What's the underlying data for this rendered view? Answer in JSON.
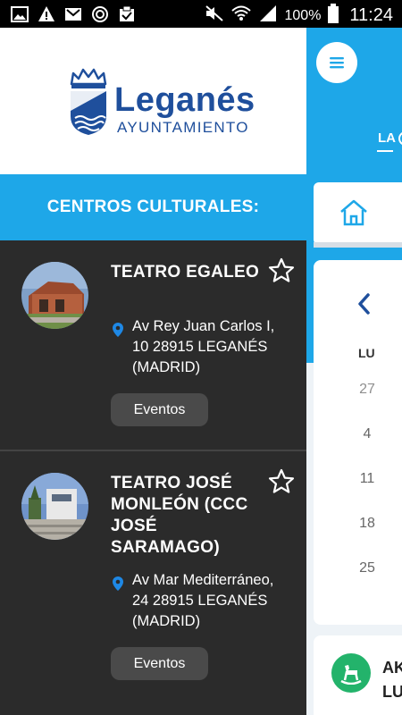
{
  "status_bar": {
    "left_icons": [
      "image-icon",
      "warning-icon",
      "gmail-icon",
      "sync-icon",
      "clipboard-check-icon"
    ],
    "right_icons": [
      "mute-icon",
      "wifi-icon",
      "signal-icon",
      "battery-icon"
    ],
    "battery_percent": "100%",
    "time": "11:24"
  },
  "drawer": {
    "logo": {
      "name": "Leganés",
      "subtitle": "AYUNTAMIENTO",
      "color": "#1f4f9c"
    },
    "section_title": "CENTROS CULTURALES:",
    "accent_color": "#1ea7e8",
    "venues": [
      {
        "name": "TEATRO EGALEO",
        "address": "Av Rey Juan Carlos I, 10 28915 LEGANÉS (MADRID)",
        "events_label": "Eventos",
        "favorite_icon": "star-outline-icon",
        "location_icon": "location-pin-icon"
      },
      {
        "name": "TEATRO JOSÉ MONLEÓN (CCC JOSÉ SARAMAGO)",
        "address": "Av Mar Mediterráneo, 24 28915 LEGANÉS (MADRID)",
        "events_label": "Eventos",
        "favorite_icon": "star-outline-icon",
        "location_icon": "location-pin-icon"
      }
    ]
  },
  "background_app": {
    "menu_icon": "hamburger-menu-icon",
    "tab_label": "LA",
    "home_icon": "home-icon",
    "calendar": {
      "prev_icon": "chevron-left-icon",
      "weekday_header": "LU",
      "day_numbers": [
        "27",
        "4",
        "11",
        "18",
        "25"
      ]
    },
    "event_card": {
      "icon": "rocking-horse-icon",
      "title_line1": "AK",
      "title_line2": "LU"
    }
  }
}
